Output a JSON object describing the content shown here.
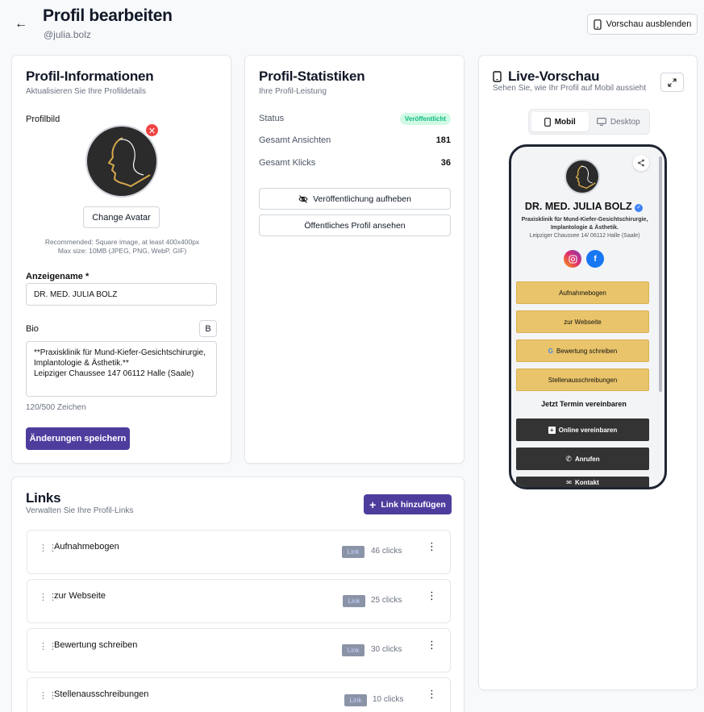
{
  "header": {
    "back_icon": "arrow-left-icon",
    "title": "Profil bearbeiten",
    "handle": "@julia.bolz",
    "preview_toggle_label": "Vorschau ausblenden"
  },
  "profile_info": {
    "title": "Profil-Informationen",
    "subtitle": "Aktualisieren Sie Ihre Profildetails",
    "avatar_label": "Profilbild",
    "change_avatar": "Change Avatar",
    "hint_line1": "Recommended: Square image, at least 400x400px",
    "hint_line2": "Max size: 10MB (JPEG, PNG, WebP, GIF)",
    "display_name_label": "Anzeigename *",
    "display_name_value": "DR. MED. JULIA BOLZ",
    "bio_label": "Bio",
    "bold_button": "B",
    "bio_value": "**Praxisklinik für Mund-Kiefer-Gesichtschirurgie, Implantologie & Ästhetik.**\nLeipziger Chaussee 147 06112 Halle (Saale)",
    "char_count": "120/500 Zeichen",
    "save_label": "Änderungen speichern"
  },
  "stats": {
    "title": "Profil-Statistiken",
    "subtitle": "Ihre Profil-Leistung",
    "status_label": "Status",
    "status_value": "Veröffentlicht",
    "views_label": "Gesamt Ansichten",
    "views_value": "181",
    "clicks_label": "Gesamt Klicks",
    "clicks_value": "36",
    "unpublish_label": "Veröffentlichung aufheben",
    "view_public_label": "Öffentliches Profil ansehen"
  },
  "links": {
    "title": "Links",
    "subtitle": "Verwalten Sie Ihre Profil-Links",
    "add_label": "Link hinzufügen",
    "items": [
      {
        "title": "Aufnahmebogen",
        "tag": "Link",
        "clicks": "46 clicks"
      },
      {
        "title": "zur Webseite",
        "tag": "Link",
        "clicks": "25 clicks"
      },
      {
        "title": "Bewertung schreiben",
        "tag": "Link",
        "clicks": "30 clicks"
      },
      {
        "title": "Stellenausschreibungen",
        "tag": "Link",
        "clicks": "10 clicks"
      }
    ]
  },
  "preview": {
    "title": "Live-Vorschau",
    "subtitle": "Sehen Sie, wie Ihr Profil auf Mobil aussieht",
    "tab_mobile": "Mobil",
    "tab_desktop": "Desktop",
    "phone": {
      "name": "DR. MED. JULIA BOLZ",
      "bio": "Praxisklinik für Mund-Kiefer-Gesichtschirurgie, Implantologie & Ästhetik.",
      "address": "Leipziger Chaussee 14/ 06112 Halle (Saale)",
      "buttons": [
        "Aufnahmebogen",
        "zur Webseite",
        "Bewertung schreiben",
        "Stellenausschreibungen"
      ],
      "section_title": "Jetzt Termin vereinbaren",
      "action_buttons": [
        "Online vereinbaren",
        "Anrufen",
        "Kontakt"
      ]
    }
  },
  "colors": {
    "primary": "#4f3d9e",
    "gold": "#e9c46a",
    "dark_button": "#333333",
    "published_green": "#10b981",
    "danger": "#ef4444"
  }
}
